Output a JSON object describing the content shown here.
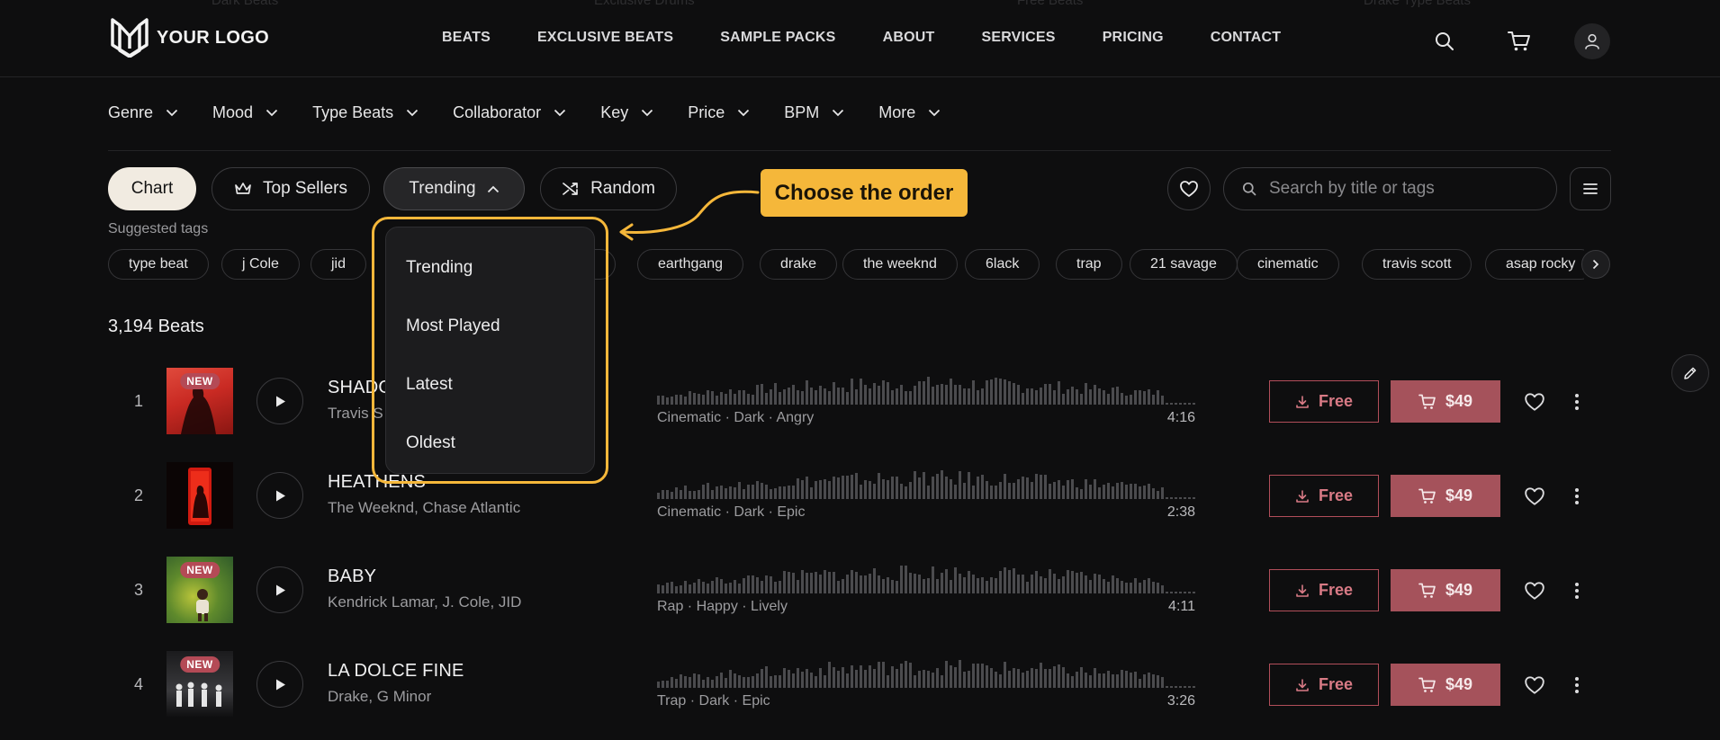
{
  "header": {
    "logo_text": "YOUR LOGO",
    "nav": [
      "BEATS",
      "EXCLUSIVE BEATS",
      "SAMPLE PACKS",
      "ABOUT",
      "SERVICES",
      "PRICING",
      "CONTACT"
    ]
  },
  "filters": [
    "Genre",
    "Mood",
    "Type Beats",
    "Collaborator",
    "Key",
    "Price",
    "BPM",
    "More"
  ],
  "controls": {
    "chart": "Chart",
    "top_sellers": "Top Sellers",
    "trending": "Trending",
    "random": "Random",
    "search_placeholder": "Search by title or tags"
  },
  "tags": {
    "label": "Suggested tags",
    "items": [
      "type beat",
      "j Cole",
      "jid",
      "",
      "earthgang",
      "drake",
      "the weeknd",
      "6lack",
      "trap",
      "21 savage",
      "cinematic",
      "travis scott",
      "asap rocky"
    ]
  },
  "beat_count": "3,194 Beats",
  "dropdown": {
    "options": [
      "Trending",
      "Most Played",
      "Latest",
      "Oldest"
    ]
  },
  "callout": "Choose the order",
  "tracks": [
    {
      "num": "1",
      "title": "SHADO",
      "artist": "Travis S",
      "moods": "Cinematic · Dark · Angry",
      "duration": "4:16",
      "is_new": true,
      "badge": "NEW",
      "free": "Free",
      "price": "$49"
    },
    {
      "num": "2",
      "title": "HEATHENS",
      "artist": "The Weeknd, Chase Atlantic",
      "moods": "Cinematic · Dark · Epic",
      "duration": "2:38",
      "is_new": false,
      "badge": "",
      "free": "Free",
      "price": "$49"
    },
    {
      "num": "3",
      "title": "BABY",
      "artist": "Kendrick Lamar, J. Cole, JID",
      "moods": "Rap · Happy · Lively",
      "duration": "4:11",
      "is_new": true,
      "badge": "NEW",
      "free": "Free",
      "price": "$49"
    },
    {
      "num": "4",
      "title": "LA DOLCE FINE",
      "artist": "Drake, G Minor",
      "moods": "Trap · Dark · Epic",
      "duration": "3:26",
      "is_new": true,
      "badge": "NEW",
      "free": "Free",
      "price": "$49"
    }
  ],
  "colors": {
    "background": "#0e0e0f",
    "accent_yellow": "#f5b73a",
    "buy_red": "#a5525b",
    "free_border": "#b24e5a"
  }
}
